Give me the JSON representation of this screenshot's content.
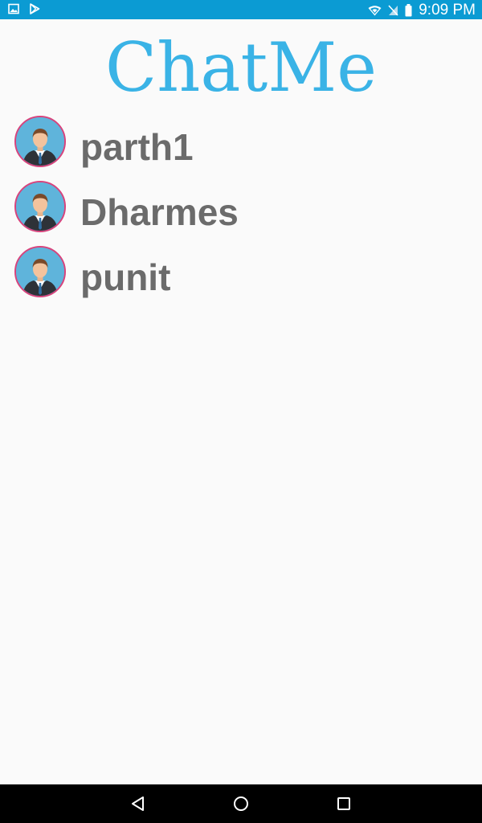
{
  "status_bar": {
    "time": "9:09 PM",
    "background_color": "#0b9bd3",
    "left_icons": [
      "gallery-icon",
      "play-store-icon"
    ],
    "right_icons": [
      "wifi-icon",
      "no-signal-icon",
      "battery-icon"
    ]
  },
  "app": {
    "title": "ChatMe",
    "title_color": "#3ab3e6"
  },
  "contacts": [
    {
      "name": "parth1",
      "avatar": "businessman-avatar"
    },
    {
      "name": "Dharmes",
      "avatar": "businessman-avatar"
    },
    {
      "name": "punit",
      "avatar": "businessman-avatar"
    }
  ],
  "nav_bar": {
    "buttons": [
      "back-icon",
      "home-icon",
      "recents-icon"
    ]
  }
}
